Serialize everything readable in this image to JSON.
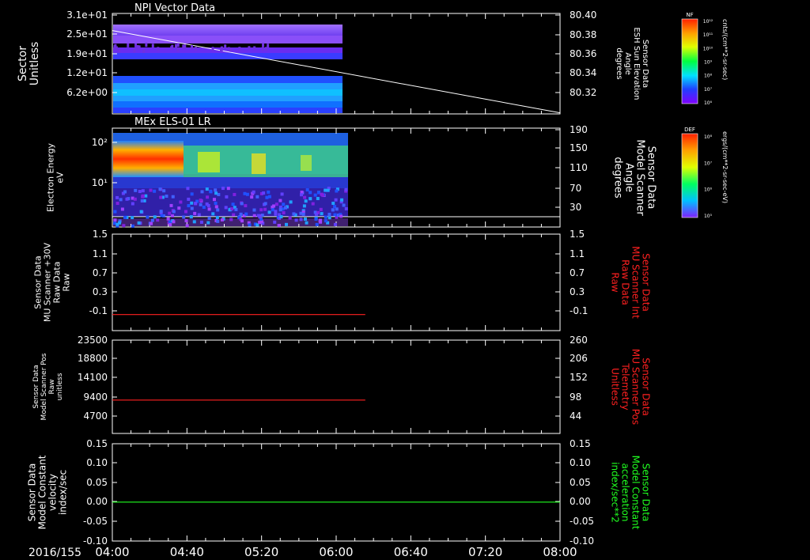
{
  "date_label": "2016/155",
  "time_ticks": [
    "04:00",
    "04:40",
    "05:20",
    "06:00",
    "06:40",
    "07:20",
    "08:00"
  ],
  "chart_data": [
    {
      "type": "heatmap",
      "title": "NPI Vector Data",
      "ylabel_left": [
        "Sector",
        "Unitless"
      ],
      "left_ticks": [
        "3.1e+01",
        "2.5e+01",
        "1.9e+01",
        "1.2e+01",
        "6.2e+00"
      ],
      "ylabel_right": [
        "Sensor Data",
        "ESH Sun Elevation",
        "Angle",
        "degrees"
      ],
      "right_ticks": [
        "80.40",
        "80.38",
        "80.36",
        "80.34",
        "80.32"
      ],
      "right_ylim": [
        80.306,
        80.4
      ],
      "line": {
        "x_hours": [
          4.0,
          8.0
        ],
        "y": [
          80.384,
          80.307
        ],
        "color": "#ffffff"
      },
      "data_extent_hours": [
        4.0,
        6.1
      ],
      "colorbar": {
        "label": "NF",
        "ticks": [
          "10¹²",
          "10¹¹",
          "10¹⁰",
          "10⁹",
          "10⁸",
          "10⁷",
          "10⁶"
        ],
        "units": "cnts/(cm**2-sr-sec)"
      }
    },
    {
      "type": "heatmap",
      "title": "MEx ELS-01 LR",
      "ylabel_left": [
        "Electron Energy",
        "eV"
      ],
      "left_ticks": [
        "10²",
        "10¹"
      ],
      "ylabel_right": [
        "Sensor Data",
        "Model Scanner",
        "Angle",
        "degrees"
      ],
      "right_ticks": [
        "190",
        "150",
        "110",
        "70",
        "30"
      ],
      "data_extent_hours": [
        4.0,
        6.16
      ],
      "colorbar": {
        "label": "DEF",
        "ticks": [
          "10⁸",
          "10⁷",
          "10⁶",
          "10⁵"
        ],
        "units": "ergs/(cm**2-sr-sec-eV)"
      }
    },
    {
      "type": "line",
      "ylabel_left": [
        "Sensor Data",
        "MU Scanner +30V",
        "Raw Data",
        "Raw"
      ],
      "left_ticks": [
        "1.5",
        "1.1",
        "0.7",
        "0.3",
        "-0.1"
      ],
      "ylim": [
        -0.3,
        1.5
      ],
      "ylabel_right": [
        "Sensor Data",
        "MU Scanner Int",
        "Raw Data",
        "Raw"
      ],
      "right_ticks": [
        "1.5",
        "1.1",
        "0.7",
        "0.3",
        "-0.1"
      ],
      "right_color": "#ff2020",
      "series": [
        {
          "x_hours": [
            4.0,
            6.26
          ],
          "y": [
            0.0,
            0.0
          ],
          "color": "#ff2020"
        }
      ]
    },
    {
      "type": "line",
      "ylabel_left": [
        "Sensor Data",
        "Model Scanner Pos",
        "Raw",
        "unitless"
      ],
      "left_ticks": [
        "23500",
        "18800",
        "14100",
        "9400",
        "4700"
      ],
      "ylim": [
        0,
        23500
      ],
      "ylabel_right": [
        "Sensor Data",
        "MU Scanner Pos",
        "Telemetry",
        "Unitless"
      ],
      "right_ticks": [
        "260",
        "206",
        "152",
        "98",
        "44"
      ],
      "right_color": "#ff2020",
      "series": [
        {
          "x_hours": [
            4.0,
            6.26
          ],
          "y": [
            8400,
            8400
          ],
          "color": "#ff2020"
        }
      ]
    },
    {
      "type": "line",
      "ylabel_left": [
        "Sensor Data",
        "Model Constant",
        "velocity",
        "index/sec"
      ],
      "left_ticks": [
        "0.15",
        "0.10",
        "0.05",
        "0.00",
        "-0.05",
        "-0.10"
      ],
      "ylim": [
        -0.1,
        0.15
      ],
      "ylabel_right": [
        "Sensor Data",
        "Model Constant",
        "acceleration",
        "index/sec**2"
      ],
      "right_ticks": [
        "0.15",
        "0.10",
        "0.05",
        "0.00",
        "-0.05",
        "-0.10"
      ],
      "right_color": "#20ff20",
      "series": [
        {
          "x_hours": [
            4.0,
            8.0
          ],
          "y": [
            0.0,
            0.0
          ],
          "color": "#20ff20"
        }
      ]
    }
  ]
}
